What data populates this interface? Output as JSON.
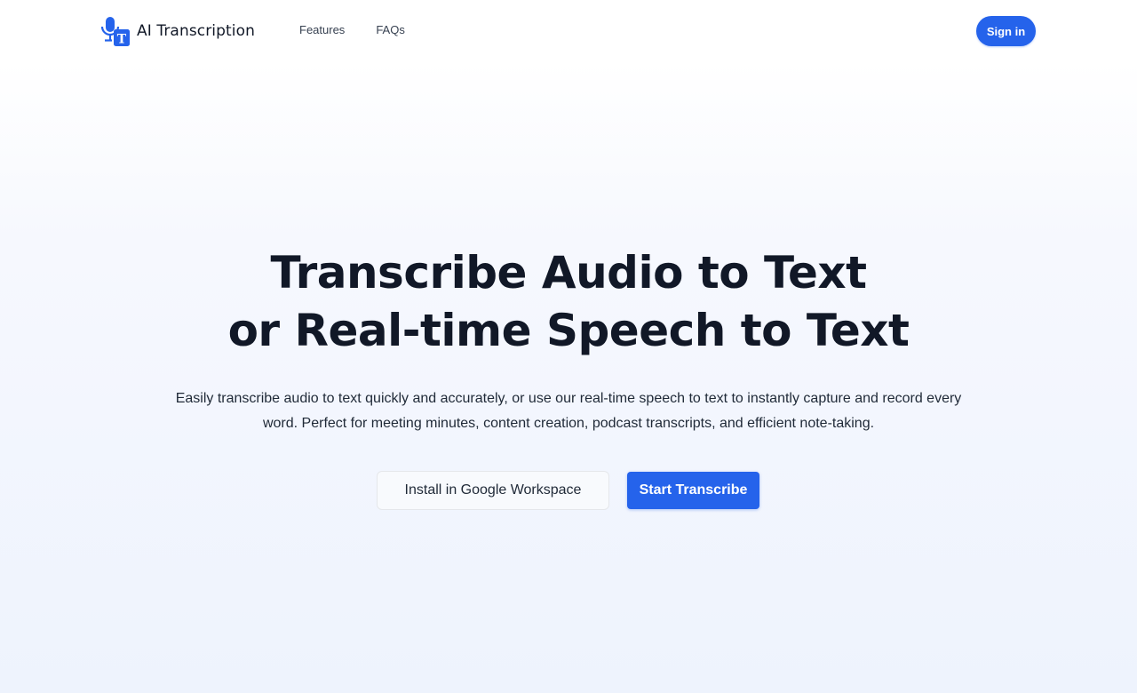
{
  "navbar": {
    "brand": {
      "name": "AI Transcription",
      "logo_icon": "microphone-text-icon",
      "logo_letter": "T",
      "color": "#2563eb"
    },
    "links": [
      {
        "label": "Features"
      },
      {
        "label": "FAQs"
      }
    ],
    "sign_in_label": "Sign in"
  },
  "hero": {
    "title_line1": "Transcribe Audio to Text",
    "title_line2": "or Real-time Speech to Text",
    "subtitle_line1": "Easily transcribe audio to text quickly and accurately, or use our real-time speech to text to instantly capture and record every",
    "subtitle_line2": "word. Perfect for meeting minutes, content creation, podcast transcripts, and efficient note-taking.",
    "secondary_button": "Install in Google Workspace",
    "primary_button": "Start Transcribe"
  },
  "colors": {
    "accent": "#2563eb",
    "text": "#111827"
  }
}
